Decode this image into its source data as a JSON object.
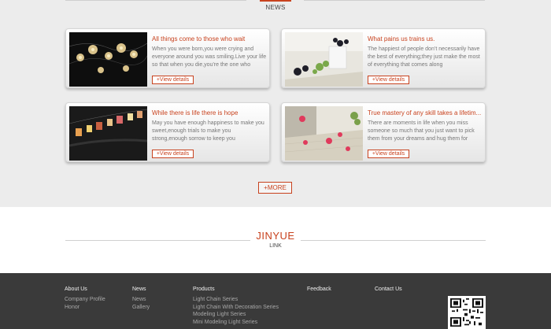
{
  "news": {
    "subtitle": "NEWS"
  },
  "cards": [
    {
      "title": "All things come to those who wait",
      "desc": "When you were born,you were crying and everyone around you was smiling.Live your life so that when you die,you're the one who",
      "more": "+View details"
    },
    {
      "title": "What pains us trains us.",
      "desc": "The happiest of people don’t necessarily have the best of everything;they just make the most of everything that comes along",
      "more": "+View details"
    },
    {
      "title": "While there is life there is hope",
      "desc": "May you have enough happiness to make you sweet,enough trials to make you strong,enough sorrow to keep you",
      "more": "+View details"
    },
    {
      "title": "True mastery of any skill takes a lifetim...",
      "desc": "There are moments in life when you miss someone so much that you just want to pick them from your dreams and hug them for",
      "more": "+View details"
    }
  ],
  "more_button": "+MORE",
  "link_section": {
    "title": "JINYUE",
    "subtitle": "LINK"
  },
  "footer": {
    "about": {
      "heading": "About Us",
      "items": [
        "Company Profile",
        "Honor"
      ]
    },
    "news": {
      "heading": "News",
      "items": [
        "News",
        "Gallery"
      ]
    },
    "products": {
      "heading": "Products",
      "items": [
        "Light Chain Series",
        "Light Chain With Decoration Series",
        "Modeling Light Series",
        "Mini Modeling Light Series"
      ]
    },
    "feedback": {
      "heading": "Feedback"
    },
    "contact": {
      "heading": "Contact Us"
    }
  },
  "colors": {
    "accent": "#c8421e",
    "footer_bg": "#3a3a3a",
    "page_bg": "#ececec"
  }
}
